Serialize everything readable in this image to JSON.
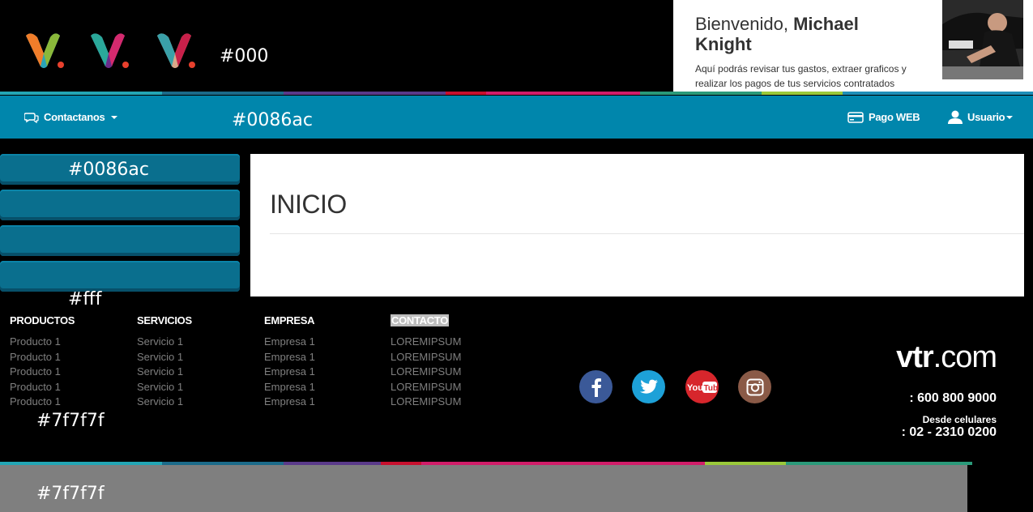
{
  "notes": {
    "header_color": "#000",
    "navbar_color": "#0086ac",
    "side_color": "#0086ac",
    "content_color": "#fff",
    "footer_color": "#7f7f7f",
    "bottom_color": "#7f7f7f"
  },
  "welcome": {
    "greeting": "Bienvenido,",
    "name": "Michael Knight",
    "text": "Aquí podrás revisar tus gastos, extraer graficos y realizar los pagos de tus servicios contratados"
  },
  "navbar": {
    "contact_label": "Contactanos",
    "pay_label": "Pago WEB",
    "user_label": "Usuario"
  },
  "content": {
    "title": "INICIO"
  },
  "footer": {
    "columns": [
      {
        "heading": "PRODUCTOS",
        "items": [
          "Producto 1",
          "Producto 1",
          "Producto 1",
          "Producto 1",
          "Producto 1"
        ]
      },
      {
        "heading": "SERVICIOS",
        "items": [
          "Servicio 1",
          "Servicio 1",
          "Servicio 1",
          "Servicio 1",
          "Servicio 1"
        ]
      },
      {
        "heading": "EMPRESA",
        "items": [
          "Empresa 1",
          "Empresa 1",
          "Empresa 1",
          "Empresa 1",
          "Empresa 1"
        ]
      },
      {
        "heading": "CONTACTO",
        "items": [
          "LOREMIPSUM",
          "LOREMIPSUM",
          "LOREMIPSUM",
          "LOREMIPSUM",
          "LOREMIPSUM"
        ]
      }
    ],
    "brand": {
      "bold": "vtr",
      "rest": ".com"
    },
    "phone_main": ": 600 800 9000",
    "mobile_label": "Desde celulares",
    "phone_mobile": ": 02 - 2310 0200",
    "social": [
      "facebook-icon",
      "twitter-icon",
      "youtube-icon",
      "instagram-icon"
    ]
  },
  "colors": {
    "navbar": "#0086ac",
    "side_button": "#0a6f8e",
    "facebook": "#3b5998",
    "twitter": "#1da1d8",
    "youtube": "#d7262c",
    "instagram": "#8a5a47"
  }
}
